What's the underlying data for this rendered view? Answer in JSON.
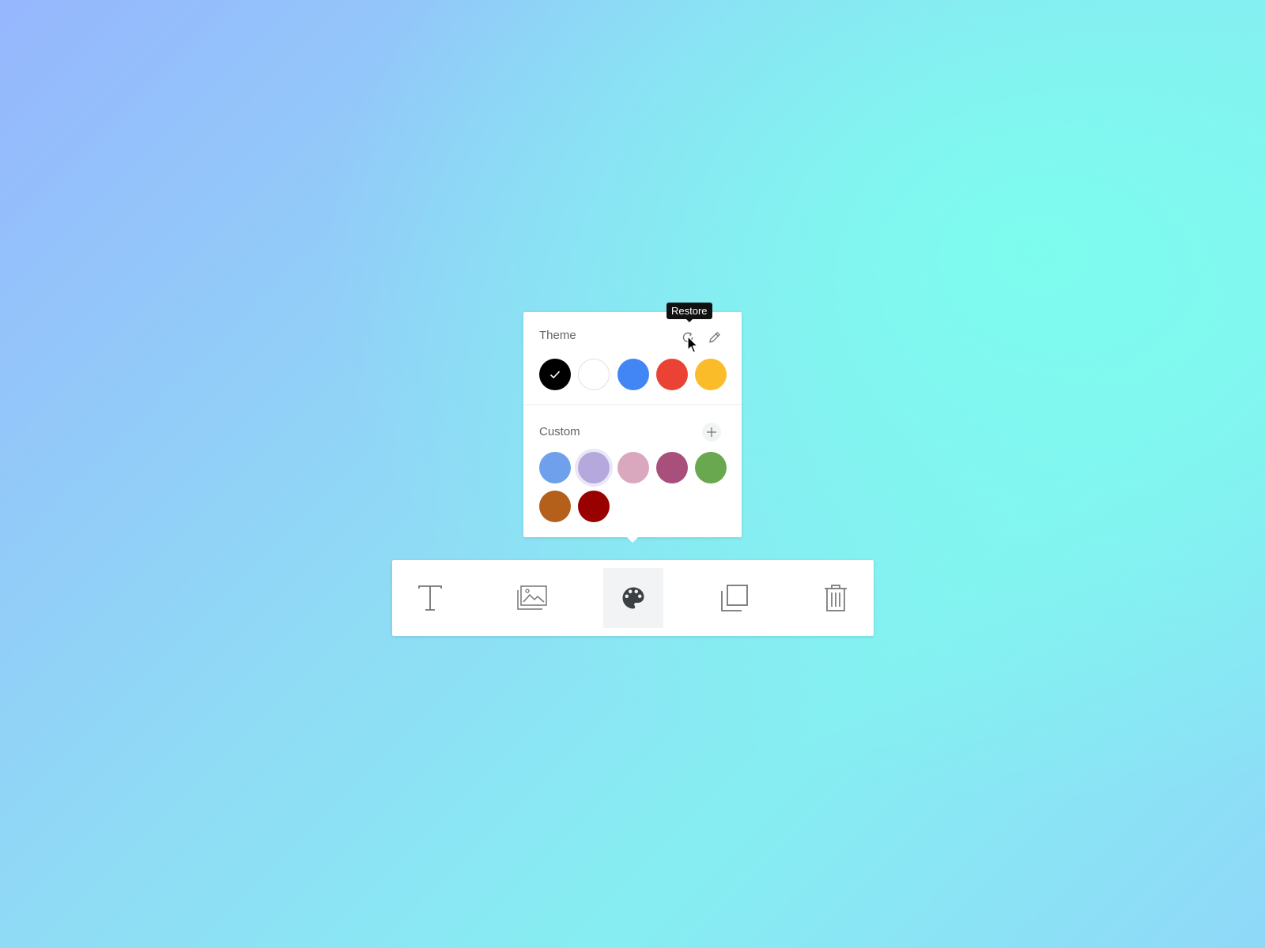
{
  "popover": {
    "theme": {
      "title": "Theme",
      "restore_icon": "restore-icon",
      "edit_icon": "pencil-icon",
      "swatches": [
        {
          "color": "#000000",
          "selected": true
        },
        {
          "color": "#ffffff",
          "selected": false
        },
        {
          "color": "#4285f4",
          "selected": false
        },
        {
          "color": "#ea4335",
          "selected": false
        },
        {
          "color": "#fbbc2a",
          "selected": false
        }
      ]
    },
    "custom": {
      "title": "Custom",
      "add_icon": "plus-icon",
      "swatches": [
        {
          "color": "#6fa0eb"
        },
        {
          "color": "#b5a8dc"
        },
        {
          "color": "#d9a8bf"
        },
        {
          "color": "#a84f7c"
        },
        {
          "color": "#6aa84f"
        },
        {
          "color": "#b45f1a"
        },
        {
          "color": "#990000"
        }
      ]
    }
  },
  "tooltip": {
    "text": "Restore"
  },
  "toolbar": {
    "tools": [
      {
        "name": "text",
        "icon": "text-icon",
        "active": false
      },
      {
        "name": "image",
        "icon": "image-icon",
        "active": false
      },
      {
        "name": "color",
        "icon": "palette-icon",
        "active": true
      },
      {
        "name": "duplicate",
        "icon": "duplicate-icon",
        "active": false
      },
      {
        "name": "delete",
        "icon": "trash-icon",
        "active": false
      }
    ]
  },
  "colors": {
    "icon_gray": "#757575",
    "active_icon": "#3c4043",
    "panel": "#ffffff"
  }
}
